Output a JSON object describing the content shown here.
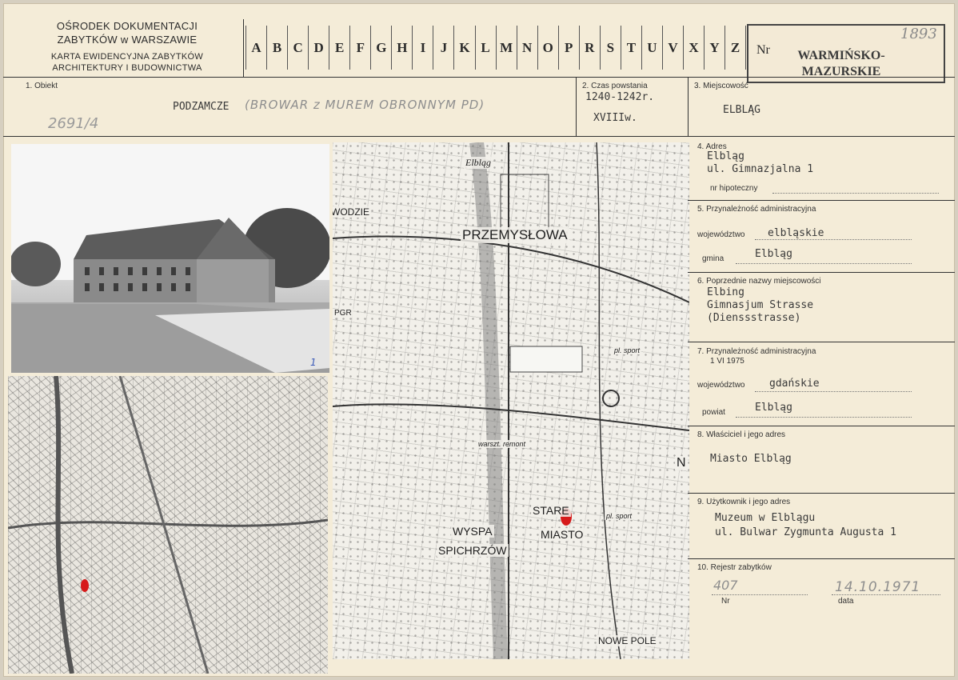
{
  "header": {
    "institution_line1": "OŚRODEK DOKUMENTACJI",
    "institution_line2": "ZABYTKÓW w WARSZAWIE",
    "card_title_line1": "KARTA EWIDENCYJNA ZABYTKÓW",
    "card_title_line2": "ARCHITEKTURY I BUDOWNICTWA",
    "alphabet": [
      "A",
      "B",
      "C",
      "D",
      "E",
      "F",
      "G",
      "H",
      "I",
      "J",
      "K",
      "L",
      "M",
      "N",
      "O",
      "P",
      "R",
      "S",
      "T",
      "U",
      "V",
      "X",
      "Y",
      "Z"
    ],
    "nr_label": "Nr",
    "region_line1": "WARMIŃSKO-",
    "region_line2": "MAZURSKIE",
    "handwritten_number": "1893"
  },
  "fields": {
    "f1": {
      "label": "1. Obiekt",
      "value": "PODZAMCZE",
      "handwritten_note": "(BROWAR z MUREM OBRONNYM PD)",
      "handwritten_code": "2691/4"
    },
    "f2": {
      "label": "2. Czas powstania",
      "line1": "1240-1242r.",
      "line2": "XVIIIw."
    },
    "f3": {
      "label": "3. Miejscowość",
      "value": "ELBLĄG"
    },
    "f4": {
      "label": "4. Adres",
      "line1": "Elbląg",
      "line2": "ul. Gimnazjalna 1",
      "nr_hip_label": "nr hipoteczny"
    },
    "f5": {
      "label": "5. Przynależność administracyjna",
      "woj_label": "województwo",
      "woj_value": "elbląskie",
      "gmina_label": "gmina",
      "gmina_value": "Elbląg"
    },
    "f6": {
      "label": "6. Poprzednie nazwy miejscowości",
      "line1": "Elbing",
      "line2": "Gimnasjum Strasse",
      "line3": "(Dienssstrasse)"
    },
    "f7": {
      "label": "7. Przynależność administracyjna",
      "date": "1 VI 1975",
      "woj_label": "województwo",
      "woj_value": "gdańskie",
      "powiat_label": "powiat",
      "powiat_value": "Elbląg"
    },
    "f8": {
      "label": "8. Właściciel i jego adres",
      "value": "Miasto Elbląg"
    },
    "f9": {
      "label": "9. Użytkownik i jego adres",
      "line1": "Muzeum w Elblągu",
      "line2": "ul. Bulwar Zygmunta Augusta 1"
    },
    "f10": {
      "label": "10. Rejestr zabytków",
      "nr_label": "Nr",
      "nr_value": "407",
      "data_label": "data",
      "data_value": "14.10.1971"
    }
  },
  "photo": {
    "number": "1"
  },
  "map_big": {
    "labels": {
      "przemyslowa": "PRZEMYSŁOWA",
      "wodzie": "WODZIE",
      "wyspa": "WYSPA",
      "spichrzow": "SPICHRZÓW",
      "stare": "STARE",
      "miasto": "MIASTO",
      "nowe_pole": "NOWE POLE",
      "elblag": "Elbląg",
      "pgr": "PGR",
      "sport1": "pl. sport",
      "sport2": "pl. sport",
      "warsztaty": "warszt. remont",
      "spalenie": "N"
    }
  },
  "colors": {
    "paper": "#f4ecd8",
    "ink": "#2b2b2b",
    "marker": "#d61a1a",
    "pencil": "#8e8e8e"
  }
}
